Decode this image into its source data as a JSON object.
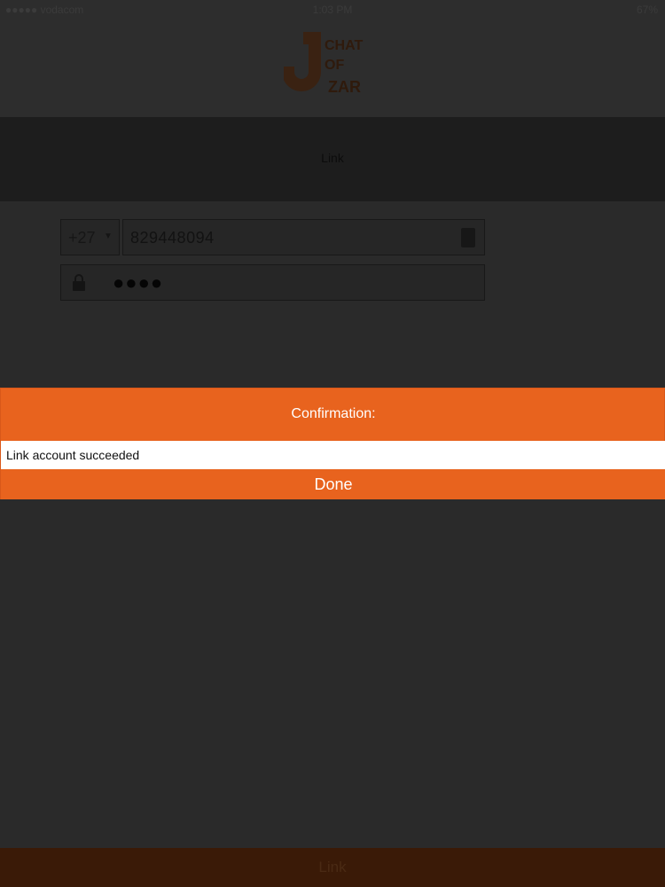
{
  "status_bar": {
    "carrier": "●●●●● vodacom",
    "time": "1:03 PM",
    "battery": "67%"
  },
  "header": {
    "logo_text_lines": [
      "CHAT",
      "OF",
      "ZAR"
    ]
  },
  "nav": {
    "title": "Link"
  },
  "form": {
    "country_code": "+27",
    "phone_number": "829448094",
    "password_mask": "●●●●"
  },
  "dialog": {
    "title": "Confirmation:",
    "message": "Link account succeeded",
    "done_label": "Done"
  },
  "footer": {
    "link_label": "Link"
  },
  "colors": {
    "accent": "#e8631e",
    "background": "#2a2a2a"
  }
}
